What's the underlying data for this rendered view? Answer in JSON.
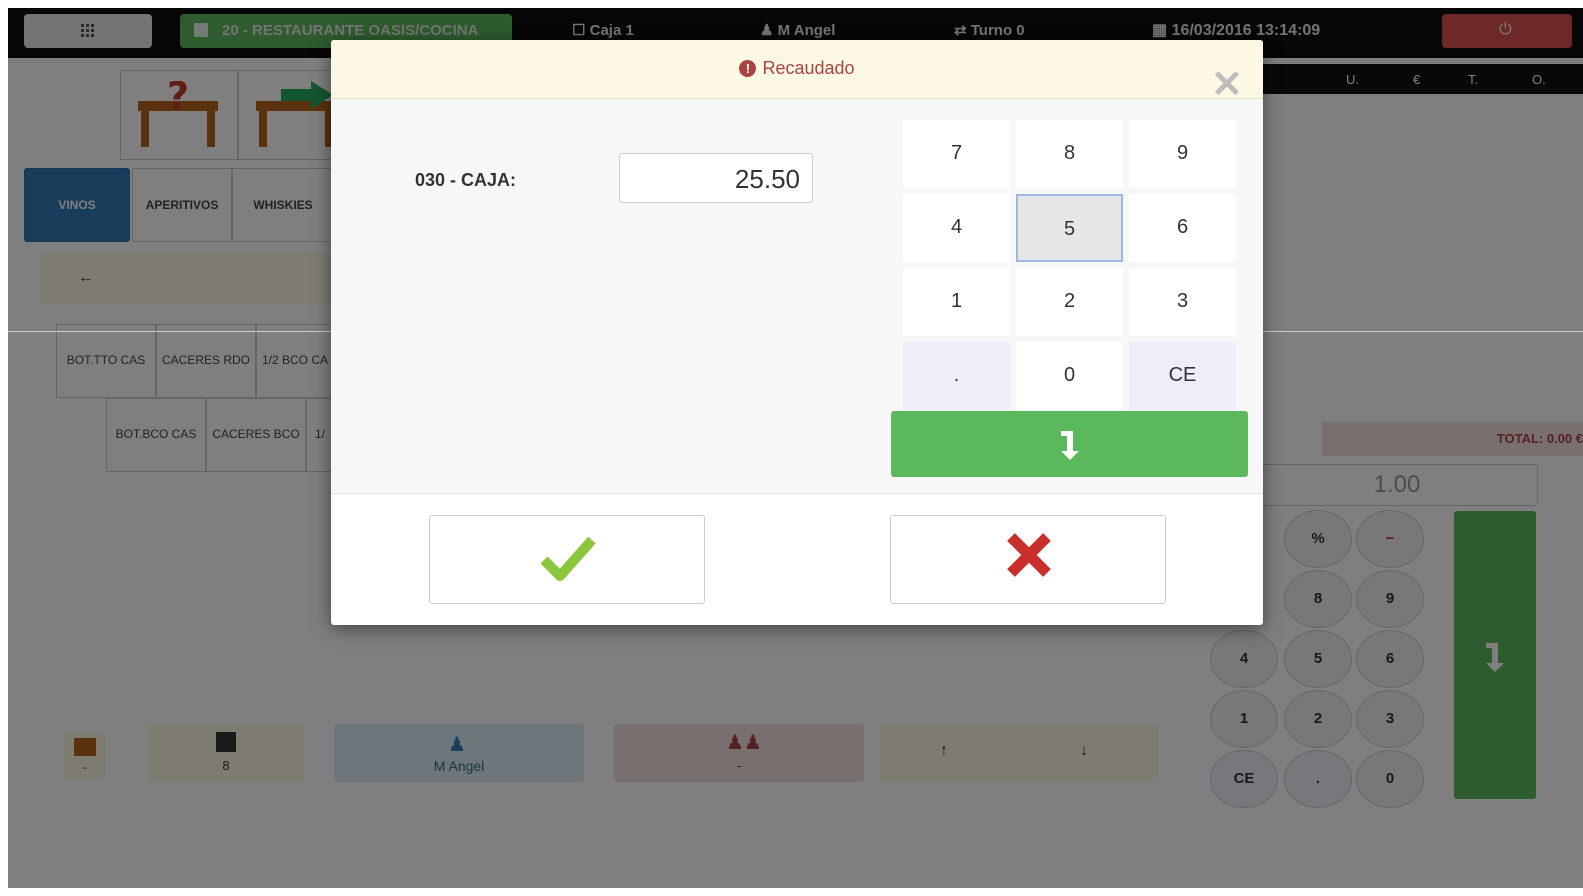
{
  "topbar": {
    "grid_icon": "grid-icon",
    "table": "20 - RESTAURANTE OASIS/COCINA",
    "register": "Caja 1",
    "user": "M Angel",
    "shift": "Turno 0",
    "datetime": "16/03/2016 13:14:09",
    "power_icon": "power-icon"
  },
  "ticket_header": {
    "col_u": "U.",
    "col_eur": "€",
    "col_t": "T.",
    "col_o": "O."
  },
  "categories": [
    "VINOS",
    "APERITIVOS",
    "WHISKIES"
  ],
  "products_row1": [
    "BOT.TTO CAS",
    "CACERES RDO",
    "1/2 BCO CA"
  ],
  "products_row2": [
    "BOT.BCO CAS",
    "CACERES BCO",
    "1/"
  ],
  "total": "TOTAL: 0.00 €",
  "qty_display": "1.00",
  "right_pad": {
    "row0": [
      "%",
      "−"
    ],
    "row1": [
      "8",
      "9"
    ],
    "row2": [
      "4",
      "5",
      "6"
    ],
    "row3": [
      "1",
      "2",
      "3"
    ],
    "row4": [
      "CE",
      ".",
      "0"
    ]
  },
  "bottom": {
    "diners_count": "8",
    "waiter": "M Angel",
    "group": "-",
    "table_label": "-"
  },
  "modal": {
    "title": "Recaudado",
    "label": "030 - CAJA:",
    "amount": "25.50",
    "keypad": [
      [
        "7",
        "8",
        "9"
      ],
      [
        "4",
        "5",
        "6"
      ],
      [
        "1",
        "2",
        "3"
      ],
      [
        ".",
        "0",
        "CE"
      ]
    ],
    "selected_key": "5",
    "accent_green": "#5cb85c",
    "confirm_color": "#8cc63f",
    "cancel_color": "#c9302c",
    "title_color": "#a94442"
  }
}
